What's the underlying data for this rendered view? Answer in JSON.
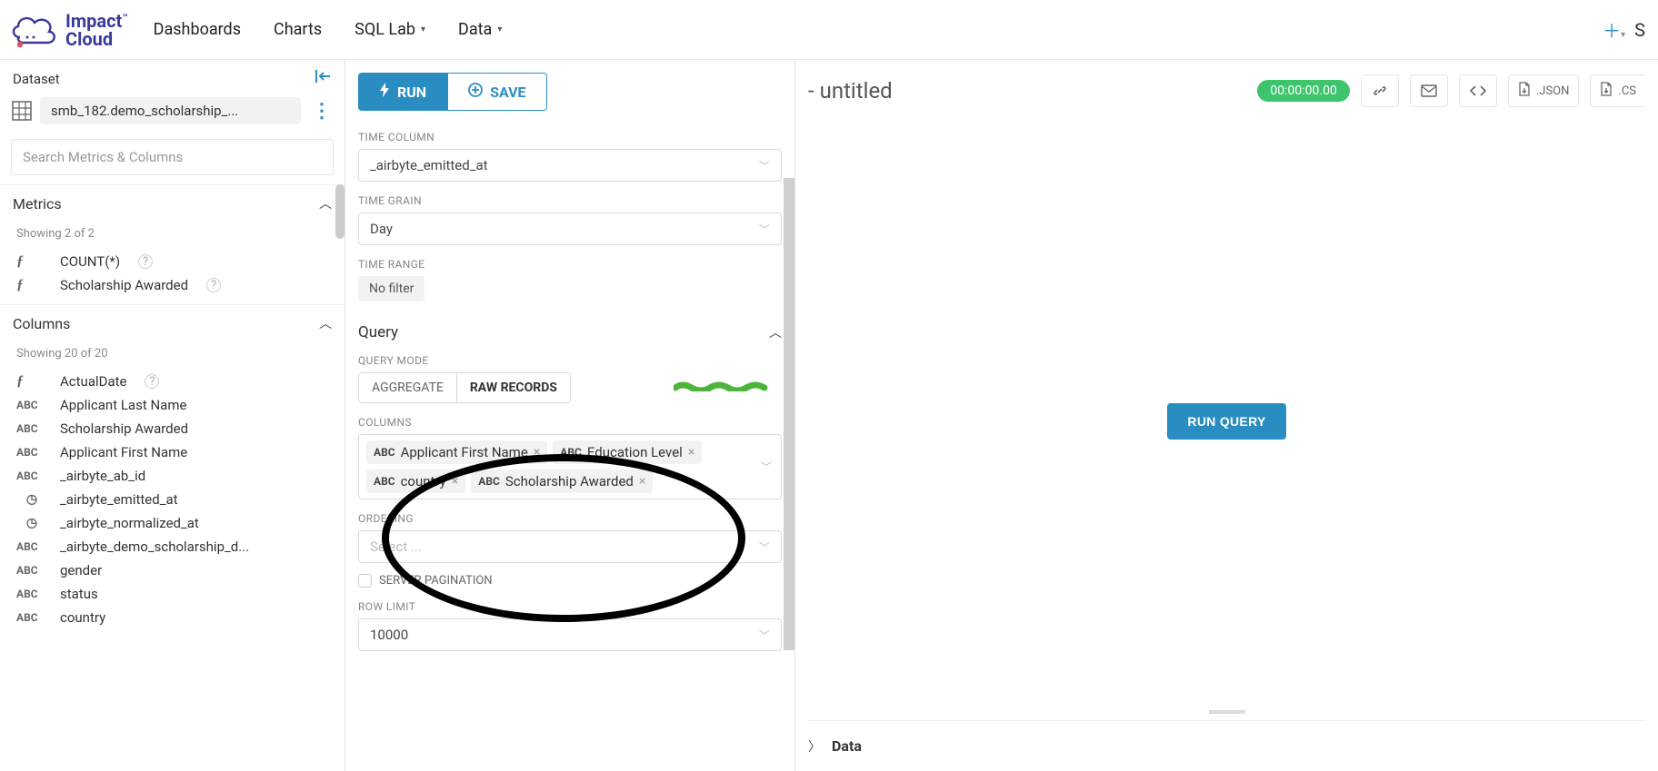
{
  "brand": {
    "line1": "Impact",
    "line2": "Cloud",
    "tm": "™"
  },
  "nav": {
    "dashboards": "Dashboards",
    "charts": "Charts",
    "sqllab": "SQL Lab",
    "data": "Data"
  },
  "sidebar": {
    "title": "Dataset",
    "dataset_name": "smb_182.demo_scholarship_...",
    "search_placeholder": "Search Metrics & Columns",
    "metrics_title": "Metrics",
    "metrics_count": "Showing 2 of 2",
    "metrics": [
      {
        "type": "fn",
        "label": "COUNT(*)",
        "help": true
      },
      {
        "type": "fn",
        "label": "Scholarship Awarded",
        "help": true
      }
    ],
    "columns_title": "Columns",
    "columns_count": "Showing 20 of 20",
    "columns": [
      {
        "type": "fn",
        "label": "ActualDate",
        "help": true
      },
      {
        "type": "ABC",
        "label": "Applicant Last Name"
      },
      {
        "type": "ABC",
        "label": "Scholarship Awarded"
      },
      {
        "type": "ABC",
        "label": "Applicant First Name"
      },
      {
        "type": "ABC",
        "label": "_airbyte_ab_id"
      },
      {
        "type": "clock",
        "label": "_airbyte_emitted_at"
      },
      {
        "type": "clock",
        "label": "_airbyte_normalized_at"
      },
      {
        "type": "ABC",
        "label": "_airbyte_demo_scholarship_d..."
      },
      {
        "type": "ABC",
        "label": "gender"
      },
      {
        "type": "ABC",
        "label": "status"
      },
      {
        "type": "ABC",
        "label": "country"
      }
    ]
  },
  "controls": {
    "run": "RUN",
    "save": "SAVE",
    "time_column_lbl": "TIME COLUMN",
    "time_column_val": "_airbyte_emitted_at",
    "time_grain_lbl": "TIME GRAIN",
    "time_grain_val": "Day",
    "time_range_lbl": "TIME RANGE",
    "time_range_val": "No filter",
    "query_title": "Query",
    "query_mode_lbl": "QUERY MODE",
    "seg_aggregate": "AGGREGATE",
    "seg_raw": "RAW RECORDS",
    "columns_lbl": "COLUMNS",
    "selected_columns": [
      {
        "label": "Applicant First Name"
      },
      {
        "label": "Education Level"
      },
      {
        "label": "country"
      },
      {
        "label": "Scholarship Awarded"
      }
    ],
    "ordering_lbl": "ORDERING",
    "ordering_placeholder": "Select ...",
    "server_pagination": "SERVER PAGINATION",
    "row_limit_lbl": "ROW LIMIT",
    "row_limit_val": "10000"
  },
  "results": {
    "title": "- untitled",
    "timer": "00:00:00.00",
    "json": ".JSON",
    "csv": ".CS",
    "run_query": "RUN QUERY",
    "data": "Data"
  }
}
